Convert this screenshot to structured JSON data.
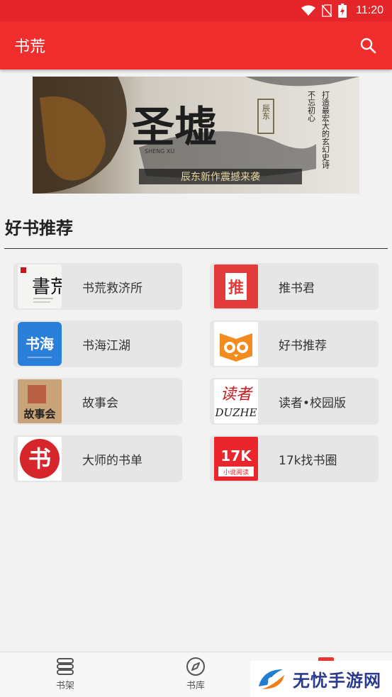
{
  "status_bar": {
    "time": "11:20"
  },
  "app_bar": {
    "title": "书荒"
  },
  "banner": {
    "title": "圣墟",
    "pinyin": "SHENG XU",
    "author": "辰东",
    "tagline": "辰东新作震撼来袭",
    "slogan_col1": "不忘初心",
    "slogan_col2": "打造最宏大的玄幻史诗"
  },
  "section": {
    "title": "好书推荐"
  },
  "books": [
    {
      "name": "书荒救济所",
      "cover_text": "書荒"
    },
    {
      "name": "推书君",
      "cover_text": "推"
    },
    {
      "name": "书海江湖",
      "cover_text": "书海"
    },
    {
      "name": "好书推荐",
      "cover_text": ""
    },
    {
      "name": "故事会",
      "cover_text": "故事会"
    },
    {
      "name": "读者•校园版",
      "cover_text": "读者",
      "cover_subtext": "DUZHE"
    },
    {
      "name": "大师的书单",
      "cover_text": "书"
    },
    {
      "name": "17k找书圈",
      "cover_text": "17K",
      "cover_subtext": "小说阅读"
    }
  ],
  "bottom_nav": {
    "items": [
      {
        "label": "书架"
      },
      {
        "label": "书库"
      }
    ]
  },
  "watermark": {
    "text": "无忧手游网"
  },
  "colors": {
    "primary": "#f02d2d",
    "status": "#e4262b"
  }
}
